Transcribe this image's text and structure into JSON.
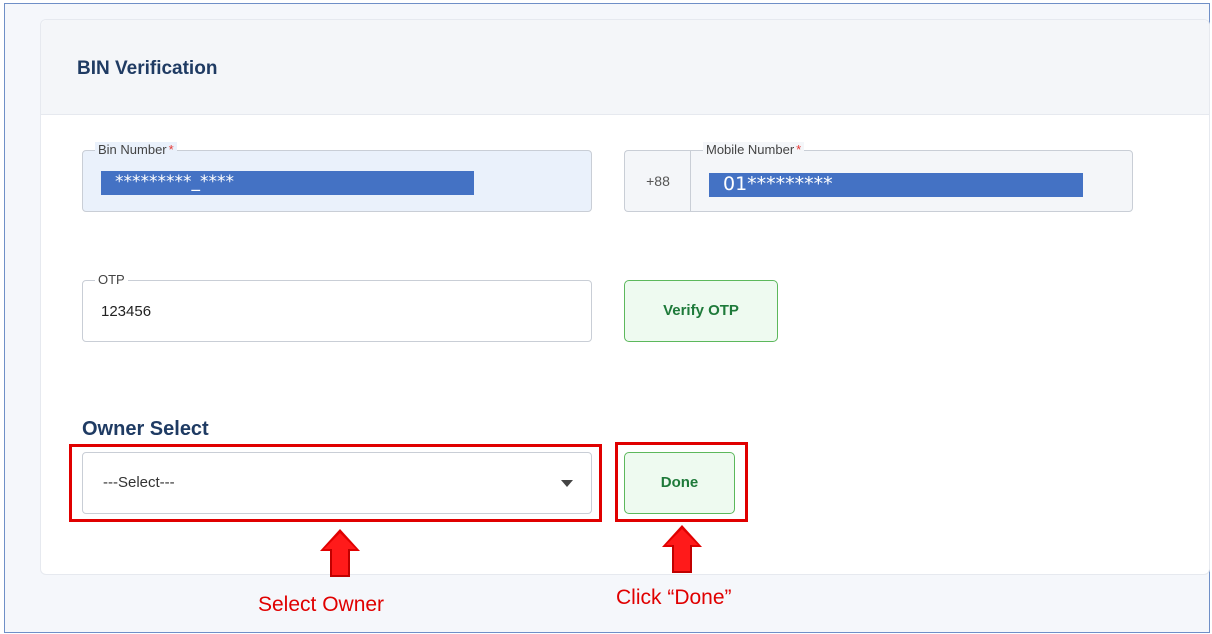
{
  "card": {
    "title": "BIN Verification"
  },
  "bin_field": {
    "label": "Bin Number",
    "required_mark": "*",
    "value": "*********_****"
  },
  "mobile_field": {
    "prefix": "+88",
    "label": "Mobile Number",
    "required_mark": "*",
    "value": "01*********"
  },
  "otp_field": {
    "label": "OTP",
    "value": "123456"
  },
  "verify_button": {
    "label": "Verify OTP"
  },
  "owner": {
    "section_label": "Owner Select",
    "selected": "---Select---",
    "done_label": "Done"
  },
  "annotations": {
    "select_owner": "Select Owner",
    "click_done": "Click “Done”"
  },
  "colors": {
    "accent": "#1f3b63",
    "button_green": "#1e7a3a",
    "annotation_red": "#e00000",
    "mask_blue": "#4472c4"
  }
}
